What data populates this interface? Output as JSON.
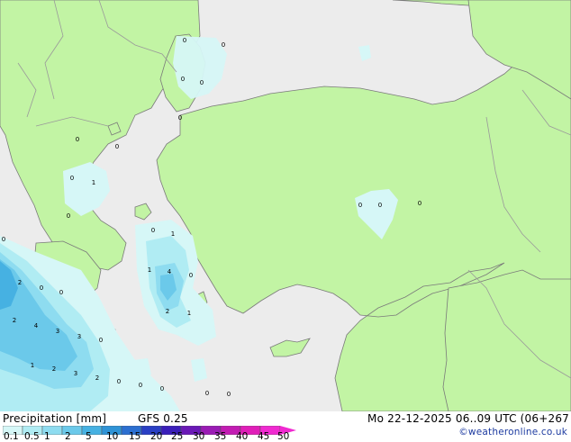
{
  "legend": {
    "title": "Precipitation [mm]",
    "model": "GFS 0.25",
    "valid": "Mo 22-12-2025 06..09 UTC (06+267",
    "credit": "©weatheronline.co.uk",
    "scale_labels": [
      "0.1",
      "0.5",
      "1",
      "2",
      "5",
      "10",
      "15",
      "20",
      "25",
      "30",
      "35",
      "40",
      "45",
      "50"
    ],
    "scale_colors": [
      "#d6f7f7",
      "#b0ecf3",
      "#8edcf0",
      "#6bc9ea",
      "#46b1e2",
      "#2f93d6",
      "#2c6fd0",
      "#2a3fc4",
      "#3a1eb9",
      "#6a19b6",
      "#9a1bb4",
      "#c21cb2",
      "#e01eb8",
      "#f02ad0"
    ]
  },
  "colors": {
    "sea": "#ececec",
    "land": "#c2f4a4",
    "border": "#9a9a9a",
    "coast": "#7a7a7a"
  },
  "map": {
    "point_values": [
      "0",
      "0",
      "0",
      "0",
      "0",
      "0",
      "0",
      "1",
      "0",
      "0",
      "0",
      "0",
      "0",
      "1",
      "0",
      "2",
      "0",
      "1",
      "4",
      "0",
      "2",
      "1",
      "0",
      "2",
      "4",
      "3",
      "3",
      "0",
      "1",
      "2",
      "3",
      "2",
      "0",
      "0",
      "0",
      "0",
      "0",
      "0"
    ]
  }
}
